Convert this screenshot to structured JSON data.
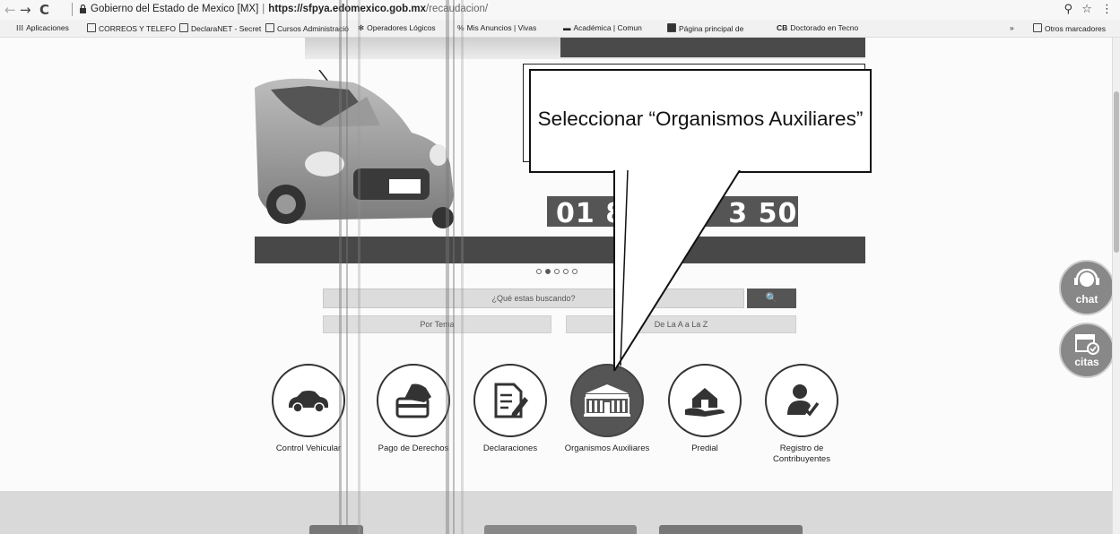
{
  "browser": {
    "back": "←",
    "forward": "→",
    "reload": "C",
    "site_name": "Gobierno del Estado de Mexico [MX]",
    "url_host": "https://sfpya.edomexico.gob.mx",
    "url_path": "/recaudacion/",
    "zoom_icon": "magnifier-icon",
    "star_icon": "star-icon",
    "menu_icon": "kebab-menu-icon"
  },
  "bookmarks": {
    "items": [
      "Aplicaciones",
      "CORREOS Y TELEFO",
      "DeclaraNET - Secret",
      "Cursos Administració",
      "Operadores Lógicos",
      "Mis Anuncios | Vivas",
      "Académica | Comun",
      "Página principal de",
      "Doctorado en Tecno"
    ],
    "more": "»",
    "others": "Otros marcadores"
  },
  "hero": {
    "phone": "01 800 ",
    "phone_end": "3 50"
  },
  "search": {
    "placeholder": "¿Qué estas buscando?",
    "button_icon": "🔍",
    "by_theme": "Por Tema",
    "by_alpha": "De La A a La Z"
  },
  "services": [
    {
      "label": "Control Vehicular"
    },
    {
      "label": "Pago de Derechos"
    },
    {
      "label": "Declaraciones"
    },
    {
      "label": "Organismos Auxiliares"
    },
    {
      "label": "Predial"
    },
    {
      "label": "Registro de Contribuyentes"
    }
  ],
  "side": {
    "chat": "chat",
    "citas": "citas"
  },
  "callout": {
    "text": "Seleccionar “Organismos Auxiliares”"
  },
  "colors": {
    "dark": "#484848",
    "selected": "#555555"
  }
}
